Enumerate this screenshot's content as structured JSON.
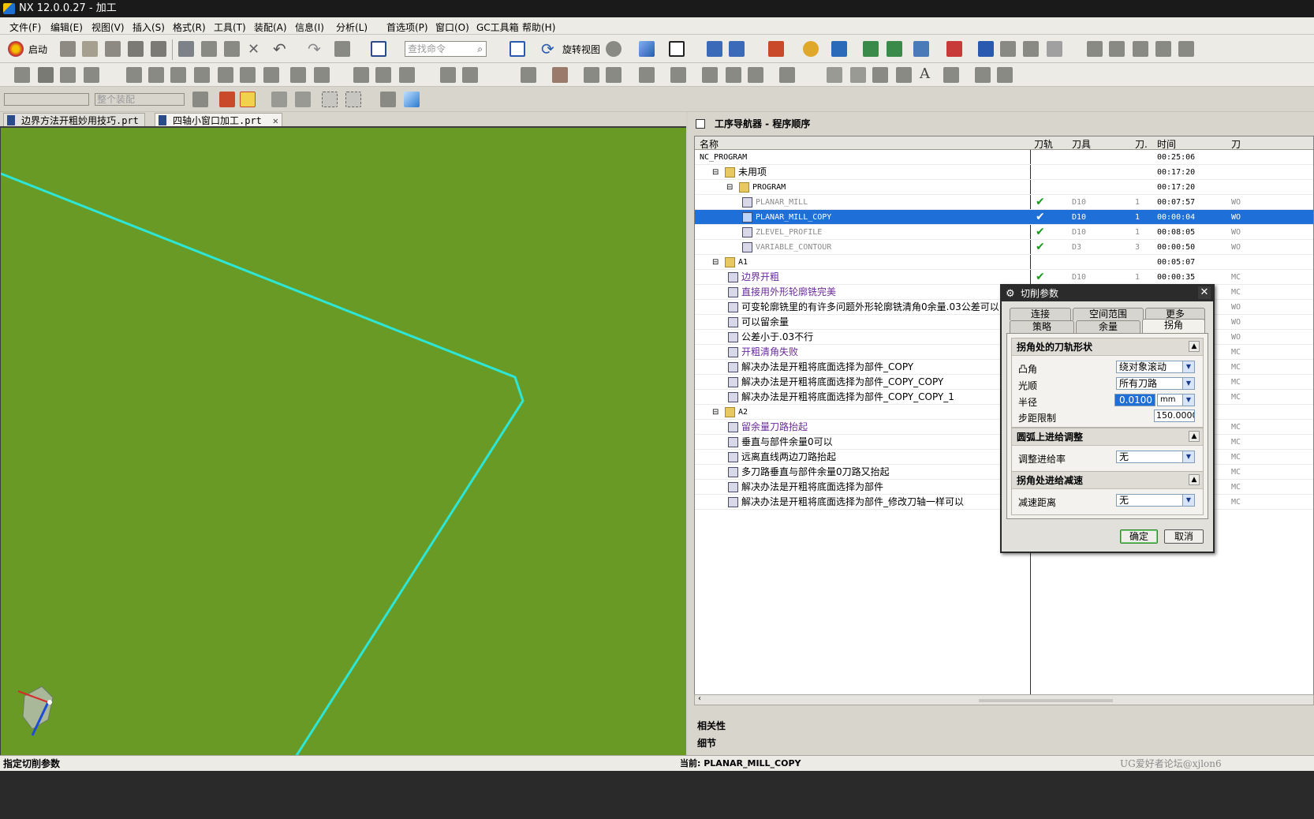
{
  "window": {
    "title": "NX 12.0.0.27 - 加工"
  },
  "menu": [
    "文件(F)",
    "编辑(E)",
    "视图(V)",
    "插入(S)",
    "格式(R)",
    "工具(T)",
    "装配(A)",
    "信息(I)",
    "分析(L)",
    "首选项(P)",
    "窗口(O)",
    "GC工具箱",
    "帮助(H)"
  ],
  "toolbar": {
    "start_label": "启动",
    "search_placeholder": "查找命令",
    "rotate_view_label": "旋转视图",
    "assembly_filter": "整个装配"
  },
  "tabs": [
    {
      "label": "边界方法开粗妙用技巧.prt"
    },
    {
      "label": "四轴小窗口加工.prt"
    }
  ],
  "navigator": {
    "title": "工序导航器 - 程序顺序",
    "columns": [
      "名称",
      "刀轨",
      "刀具",
      "刀.",
      "时间",
      "刀"
    ],
    "rows": [
      {
        "name": "NC_PROGRAM",
        "time": "00:25:06",
        "indent": 0
      },
      {
        "name": "未用项",
        "time": "00:17:20",
        "indent": 1,
        "expander": "⊟"
      },
      {
        "name": "PROGRAM",
        "time": "00:17:20",
        "indent": 2,
        "expander": "⊟"
      },
      {
        "name": "PLANAR_MILL",
        "tool": "D10",
        "num": "1",
        "time": "00:07:57",
        "check": "✔",
        "col6": "WO",
        "indent": 3,
        "style": "gray"
      },
      {
        "name": "PLANAR_MILL_COPY",
        "tool": "D10",
        "num": "1",
        "time": "00:00:04",
        "check": "✔",
        "col6": "WO",
        "indent": 3,
        "selected": true
      },
      {
        "name": "ZLEVEL_PROFILE",
        "tool": "D10",
        "num": "1",
        "time": "00:08:05",
        "check": "✔",
        "col6": "WO",
        "indent": 3,
        "style": "gray"
      },
      {
        "name": "VARIABLE_CONTOUR",
        "tool": "D3",
        "num": "3",
        "time": "00:00:50",
        "check": "✔",
        "col6": "WO",
        "indent": 3,
        "style": "gray"
      },
      {
        "name": "A1",
        "time": "00:05:07",
        "indent": 1,
        "expander": "⊟"
      },
      {
        "name": "边界开粗",
        "tool": "D10",
        "num": "1",
        "time": "00:00:35",
        "check": "✔",
        "col6": "MC",
        "indent": 2,
        "style": "purple"
      },
      {
        "name": "直接用外形轮廓铣完美",
        "col6": "MC",
        "indent": 2,
        "style": "purple"
      },
      {
        "name": "可变轮廓铣里的有许多问题外形轮廓铣清角0余量.03公差可以",
        "col6": "WO",
        "indent": 2
      },
      {
        "name": "可以留余量",
        "col6": "WO",
        "indent": 2
      },
      {
        "name": "公差小于.03不行",
        "col6": "WO",
        "indent": 2
      },
      {
        "name": "开粗清角失败",
        "col6": "MC",
        "indent": 2,
        "style": "purple"
      },
      {
        "name": "解决办法是开粗将底面选择为部件_COPY",
        "col6": "MC",
        "indent": 2
      },
      {
        "name": "解决办法是开粗将底面选择为部件_COPY_COPY",
        "col6": "MC",
        "indent": 2
      },
      {
        "name": "解决办法是开粗将底面选择为部件_COPY_COPY_1",
        "col6": "MC",
        "indent": 2
      },
      {
        "name": "A2",
        "indent": 1,
        "expander": "⊟"
      },
      {
        "name": "留余量刀路抬起",
        "col6": "MC",
        "indent": 2,
        "style": "purple"
      },
      {
        "name": "垂直与部件余量0可以",
        "col6": "MC",
        "indent": 2
      },
      {
        "name": "远离直线两边刀路抬起",
        "col6": "MC",
        "indent": 2
      },
      {
        "name": "多刀路垂直与部件余量0刀路又抬起",
        "col6": "MC",
        "indent": 2
      },
      {
        "name": "解决办法是开粗将底面选择为部件",
        "col6": "MC",
        "indent": 2
      },
      {
        "name": "解决办法是开粗将底面选择为部件_修改刀轴一样可以",
        "col6": "MC",
        "indent": 2
      }
    ],
    "sections": [
      "相关性",
      "细节"
    ]
  },
  "dialog": {
    "title": "切削参数",
    "tabs_row1": [
      "连接",
      "空间范围",
      "更多"
    ],
    "tabs_row2": [
      "策略",
      "余量",
      "拐角"
    ],
    "sections": [
      {
        "title": "拐角处的刀轨形状",
        "fields": [
          {
            "label": "凸角",
            "value": "绕对象滚动"
          },
          {
            "label": "光顺",
            "value": "所有刀路"
          },
          {
            "label": "半径",
            "value": "0.0100",
            "unit": "mm"
          },
          {
            "label": "步距限制",
            "value": "150.00000"
          }
        ]
      },
      {
        "title": "圆弧上进给调整",
        "fields": [
          {
            "label": "调整进给率",
            "value": "无"
          }
        ]
      },
      {
        "title": "拐角处进给减速",
        "fields": [
          {
            "label": "减速距离",
            "value": "无"
          }
        ]
      }
    ],
    "ok": "确定",
    "cancel": "取消"
  },
  "status": {
    "left": "指定切削参数",
    "current": "当前: PLANAR_MILL_COPY",
    "watermark": "UG爱好者论坛@xjlon6"
  },
  "colors": {
    "viewport_bg": "#689a25",
    "toolpath": "#2ee6d6",
    "selection": "#1f6fd8"
  }
}
